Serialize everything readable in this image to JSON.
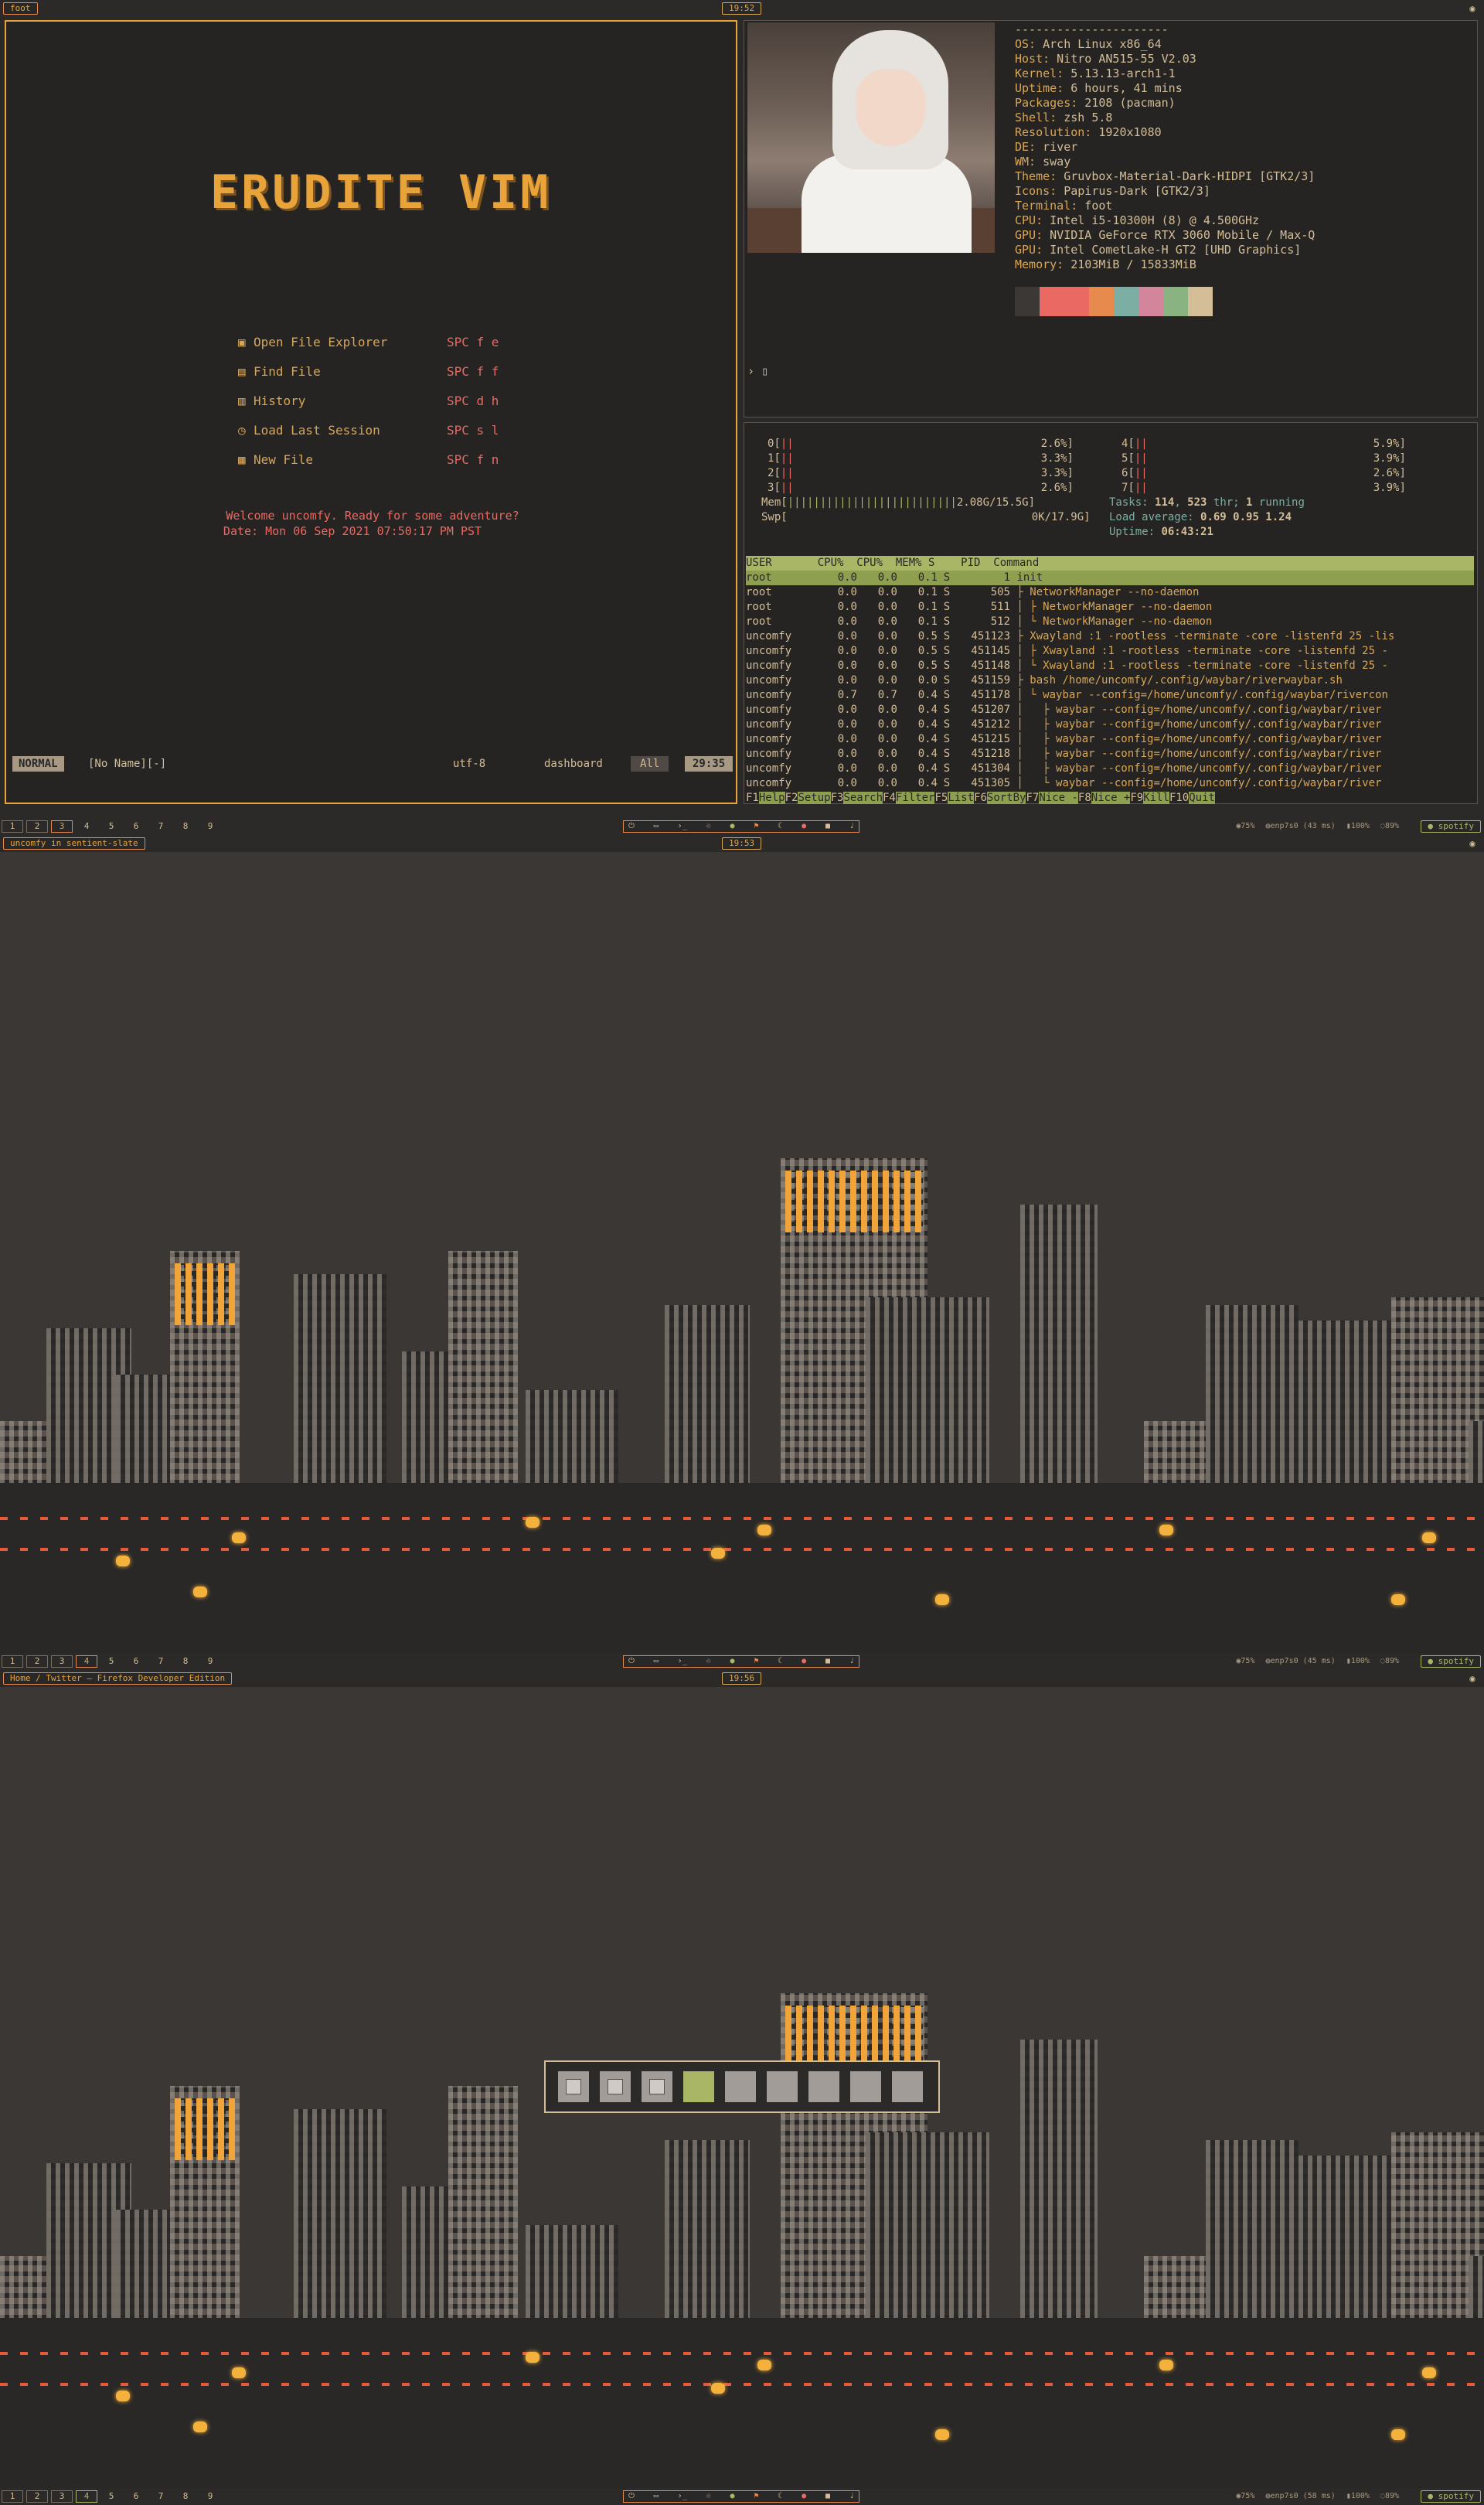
{
  "screens": [
    {
      "window_title": "foot",
      "clock": "19:52",
      "workspaces": [
        "1",
        "2",
        "3",
        "4",
        "5",
        "6",
        "7",
        "8",
        "9"
      ]
    },
    {
      "window_title": "uncomfy in sentient-slate",
      "clock": "19:53",
      "workspaces": [
        "1",
        "2",
        "3",
        "4",
        "5",
        "6",
        "7",
        "8",
        "9"
      ]
    },
    {
      "window_title": "Home / Twitter — Firefox Developer Edition",
      "clock": "19:56",
      "workspaces": [
        "1",
        "2",
        "3",
        "4",
        "5",
        "6",
        "7",
        "8",
        "9"
      ]
    }
  ],
  "statusbar": {
    "cpu": "75%",
    "net1": "enp7s0 (43 ms)",
    "net2": "enp7s0 (45 ms)",
    "net3": "enp7s0 (58 ms)",
    "vol": "100%",
    "bat": "89%",
    "spotify": "spotify"
  },
  "vim": {
    "logo": "ERUDITE VIM",
    "menu": [
      {
        "label": "Open File Explorer",
        "key": "SPC f e"
      },
      {
        "label": "Find File",
        "key": "SPC f f"
      },
      {
        "label": "History",
        "key": "SPC d h"
      },
      {
        "label": "Load Last Session",
        "key": "SPC s l"
      },
      {
        "label": "New File",
        "key": "SPC f n"
      }
    ],
    "welcome": "Welcome uncomfy. Ready for some adventure?",
    "date": "Date: Mon 06 Sep 2021 07:50:17 PM PST",
    "mode": "NORMAL",
    "filename": "[No Name][-]",
    "encoding": "utf-8",
    "filetype": "dashboard",
    "scroll": "All",
    "position": "29:35"
  },
  "fetch": {
    "separator": "----------------------",
    "rows": [
      {
        "k": "OS:",
        "v": " Arch Linux x86_64"
      },
      {
        "k": "Host:",
        "v": " Nitro AN515-55 V2.03"
      },
      {
        "k": "Kernel:",
        "v": " 5.13.13-arch1-1"
      },
      {
        "k": "Uptime:",
        "v": " 6 hours, 41 mins"
      },
      {
        "k": "Packages:",
        "v": " 2108 (pacman)"
      },
      {
        "k": "Shell:",
        "v": " zsh 5.8"
      },
      {
        "k": "Resolution:",
        "v": " 1920x1080"
      },
      {
        "k": "DE:",
        "v": " river"
      },
      {
        "k": "WM:",
        "v": " sway"
      },
      {
        "k": "Theme:",
        "v": " Gruvbox-Material-Dark-HIDPI [GTK2/3]"
      },
      {
        "k": "Icons:",
        "v": " Papirus-Dark [GTK2/3]"
      },
      {
        "k": "Terminal:",
        "v": " foot"
      },
      {
        "k": "CPU:",
        "v": " Intel i5-10300H (8) @ 4.500GHz"
      },
      {
        "k": "GPU:",
        "v": " NVIDIA GeForce RTX 3060 Mobile / Max-Q"
      },
      {
        "k": "GPU:",
        "v": " Intel CometLake-H GT2 [UHD Graphics]"
      },
      {
        "k": "Memory:",
        "v": " 2103MiB / 15833MiB"
      }
    ],
    "palette": [
      "#3c3836",
      "#ea6962",
      "#ea6962",
      "#e78a4e",
      "#7daea3",
      "#d3869b",
      "#89b482",
      "#d4be98"
    ],
    "prompt": "›"
  },
  "htop": {
    "cpus": [
      {
        "id": "0",
        "pct": "2.6%"
      },
      {
        "id": "1",
        "pct": "3.3%"
      },
      {
        "id": "2",
        "pct": "3.3%"
      },
      {
        "id": "3",
        "pct": "2.6%"
      },
      {
        "id": "4",
        "pct": "5.9%"
      },
      {
        "id": "5",
        "pct": "3.9%"
      },
      {
        "id": "6",
        "pct": "2.6%"
      },
      {
        "id": "7",
        "pct": "3.9%"
      }
    ],
    "mem": "2.08G/15.5G",
    "swp": "0K/17.9G",
    "tasks": "114",
    "threads": "523",
    "running": "1",
    "load": "0.69 0.95 1.24",
    "uptime": "06:43:21",
    "header": "USER       CPU%  CPU%  MEM% S    PID  Command",
    "processes": [
      {
        "user": "root",
        "cpu": "0.0",
        "cpu2": "0.0",
        "mem": "0.1",
        "s": "S",
        "pid": "1",
        "cmd": "init"
      },
      {
        "user": "root",
        "cpu": "0.0",
        "cpu2": "0.0",
        "mem": "0.1",
        "s": "S",
        "pid": "505",
        "cmd": "├ NetworkManager --no-daemon"
      },
      {
        "user": "root",
        "cpu": "0.0",
        "cpu2": "0.0",
        "mem": "0.1",
        "s": "S",
        "pid": "511",
        "cmd": "│ ├ NetworkManager --no-daemon"
      },
      {
        "user": "root",
        "cpu": "0.0",
        "cpu2": "0.0",
        "mem": "0.1",
        "s": "S",
        "pid": "512",
        "cmd": "│ └ NetworkManager --no-daemon"
      },
      {
        "user": "uncomfy",
        "cpu": "0.0",
        "cpu2": "0.0",
        "mem": "0.5",
        "s": "S",
        "pid": "451123",
        "cmd": "├ Xwayland :1 -rootless -terminate -core -listenfd 25 -lis"
      },
      {
        "user": "uncomfy",
        "cpu": "0.0",
        "cpu2": "0.0",
        "mem": "0.5",
        "s": "S",
        "pid": "451145",
        "cmd": "│ ├ Xwayland :1 -rootless -terminate -core -listenfd 25 -"
      },
      {
        "user": "uncomfy",
        "cpu": "0.0",
        "cpu2": "0.0",
        "mem": "0.5",
        "s": "S",
        "pid": "451148",
        "cmd": "│ └ Xwayland :1 -rootless -terminate -core -listenfd 25 -"
      },
      {
        "user": "uncomfy",
        "cpu": "0.0",
        "cpu2": "0.0",
        "mem": "0.0",
        "s": "S",
        "pid": "451159",
        "cmd": "├ bash /home/uncomfy/.config/waybar/riverwaybar.sh"
      },
      {
        "user": "uncomfy",
        "cpu": "0.7",
        "cpu2": "0.7",
        "mem": "0.4",
        "s": "S",
        "pid": "451178",
        "cmd": "│ └ waybar --config=/home/uncomfy/.config/waybar/rivercon"
      },
      {
        "user": "uncomfy",
        "cpu": "0.0",
        "cpu2": "0.0",
        "mem": "0.4",
        "s": "S",
        "pid": "451207",
        "cmd": "│   ├ waybar --config=/home/uncomfy/.config/waybar/river"
      },
      {
        "user": "uncomfy",
        "cpu": "0.0",
        "cpu2": "0.0",
        "mem": "0.4",
        "s": "S",
        "pid": "451212",
        "cmd": "│   ├ waybar --config=/home/uncomfy/.config/waybar/river"
      },
      {
        "user": "uncomfy",
        "cpu": "0.0",
        "cpu2": "0.0",
        "mem": "0.4",
        "s": "S",
        "pid": "451215",
        "cmd": "│   ├ waybar --config=/home/uncomfy/.config/waybar/river"
      },
      {
        "user": "uncomfy",
        "cpu": "0.0",
        "cpu2": "0.0",
        "mem": "0.4",
        "s": "S",
        "pid": "451218",
        "cmd": "│   ├ waybar --config=/home/uncomfy/.config/waybar/river"
      },
      {
        "user": "uncomfy",
        "cpu": "0.0",
        "cpu2": "0.0",
        "mem": "0.4",
        "s": "S",
        "pid": "451304",
        "cmd": "│   ├ waybar --config=/home/uncomfy/.config/waybar/river"
      },
      {
        "user": "uncomfy",
        "cpu": "0.0",
        "cpu2": "0.0",
        "mem": "0.4",
        "s": "S",
        "pid": "451305",
        "cmd": "│   └ waybar --config=/home/uncomfy/.config/waybar/river"
      }
    ],
    "fkeys": [
      {
        "n": "F1",
        "l": "Help"
      },
      {
        "n": "F2",
        "l": "Setup"
      },
      {
        "n": "F3",
        "l": "Search"
      },
      {
        "n": "F4",
        "l": "Filter"
      },
      {
        "n": "F5",
        "l": "List"
      },
      {
        "n": "F6",
        "l": "SortBy"
      },
      {
        "n": "F7",
        "l": "Nice -"
      },
      {
        "n": "F8",
        "l": "Nice +"
      },
      {
        "n": "F9",
        "l": "Kill"
      },
      {
        "n": "F10",
        "l": "Quit"
      }
    ]
  }
}
